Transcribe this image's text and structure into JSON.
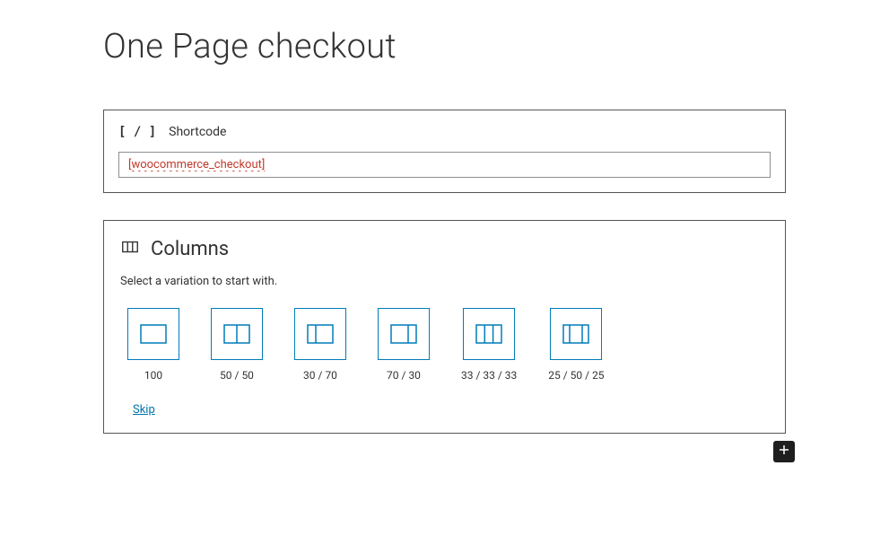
{
  "page": {
    "title": "One Page checkout"
  },
  "shortcode_block": {
    "label": "Shortcode",
    "value": "[woocommerce_checkout]"
  },
  "columns_block": {
    "title": "Columns",
    "description": "Select a variation to start with.",
    "variations": [
      {
        "label": "100"
      },
      {
        "label": "50 / 50"
      },
      {
        "label": "30 / 70"
      },
      {
        "label": "70 / 30"
      },
      {
        "label": "33 / 33 / 33"
      },
      {
        "label": "25 / 50 / 25"
      }
    ],
    "skip_label": "Skip"
  },
  "colors": {
    "accent": "#007cba",
    "link": "#0073aa",
    "error_text": "#c1392b"
  }
}
